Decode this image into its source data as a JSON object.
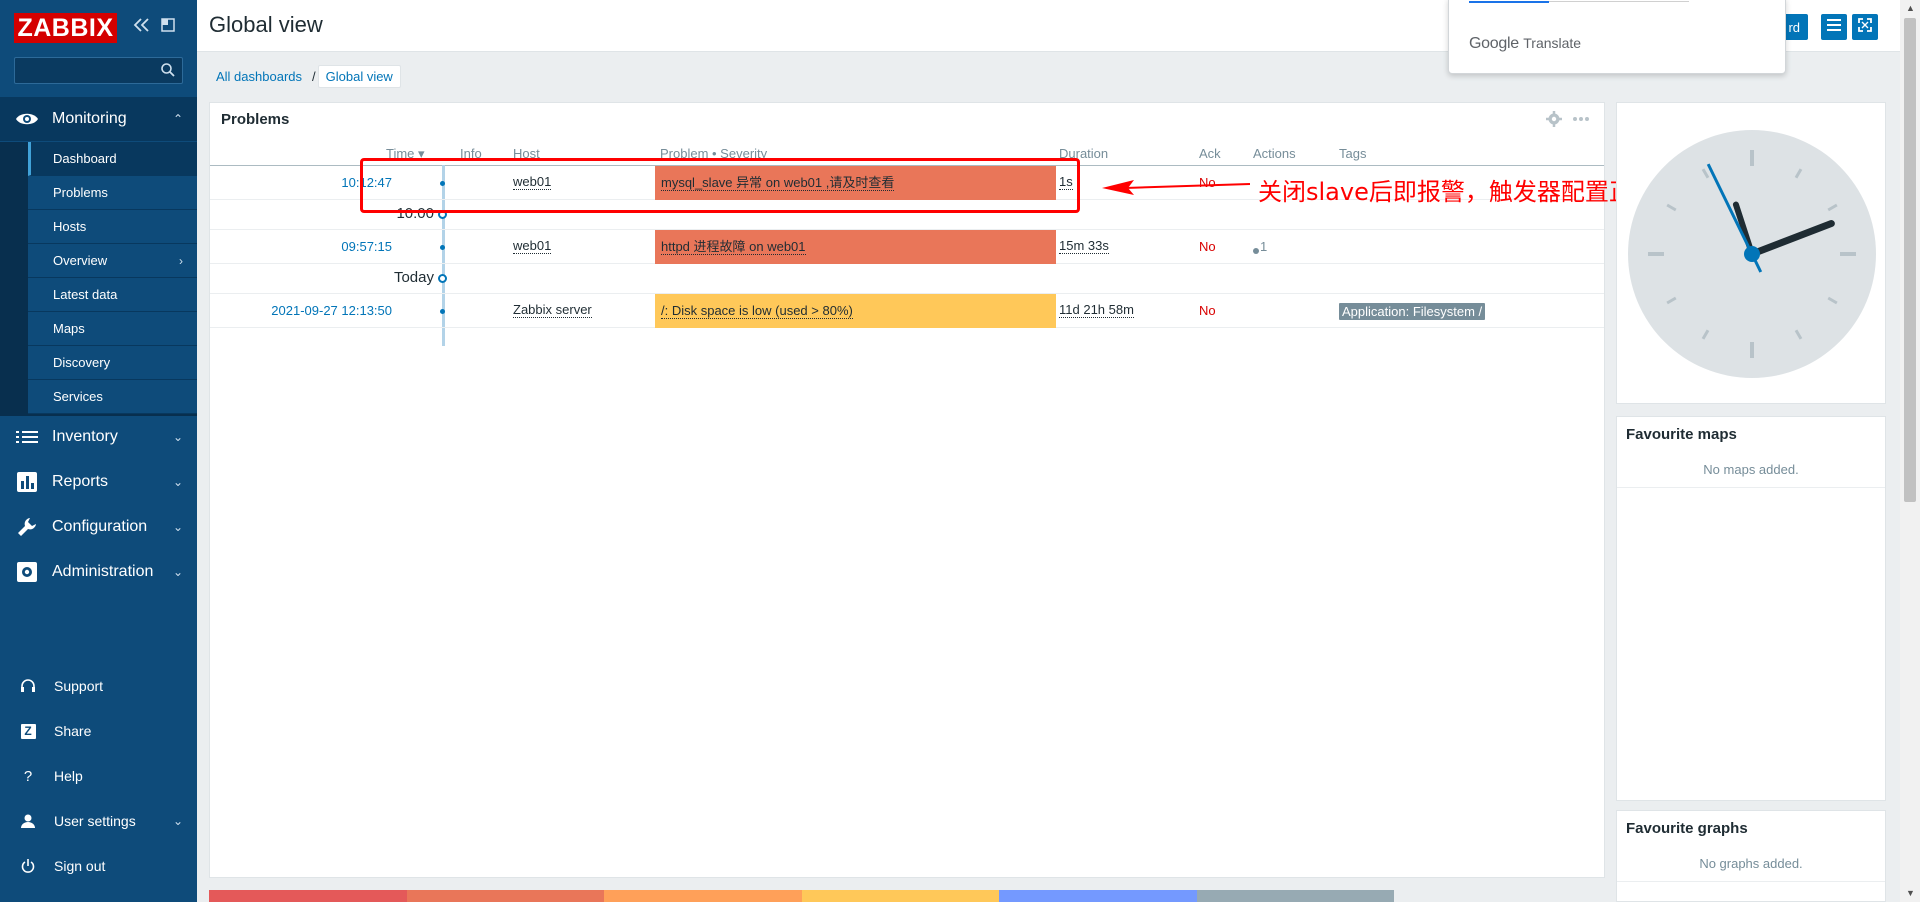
{
  "brand": {
    "logo_text": "ZABBIX"
  },
  "search": {
    "placeholder": ""
  },
  "sidebar": {
    "monitoring": "Monitoring",
    "monitoring_sub": [
      "Dashboard",
      "Problems",
      "Hosts",
      "Overview",
      "Latest data",
      "Maps",
      "Discovery",
      "Services"
    ],
    "inventory": "Inventory",
    "reports": "Reports",
    "configuration": "Configuration",
    "administration": "Administration",
    "footer": [
      "Support",
      "Share",
      "Help",
      "User settings",
      "Sign out"
    ],
    "share_glyph": "Z",
    "help_glyph": "?"
  },
  "header": {
    "title": "Global view",
    "edit_label": "rd"
  },
  "translate": {
    "google": "Google",
    "translate": "Translate"
  },
  "breadcrumb": {
    "root": "All dashboards",
    "sep": "/",
    "current": "Global view"
  },
  "problems": {
    "title": "Problems",
    "columns": {
      "time": "Time",
      "info": "Info",
      "host": "Host",
      "problem": "Problem • Severity",
      "duration": "Duration",
      "ack": "Ack",
      "actions": "Actions",
      "tags": "Tags"
    },
    "time_sort": "▾",
    "rows": [
      {
        "time": "10:12:47",
        "host": "web01",
        "problem": "mysql_slave 异常 on web01 ,请及时查看",
        "duration": "1s",
        "ack": "No",
        "actions": "",
        "tag": "",
        "color": "#e97659"
      },
      {
        "group": "10:00"
      },
      {
        "time": "09:57:15",
        "host": "web01",
        "problem": "httpd 进程故障 on web01",
        "duration": "15m 33s",
        "ack": "No",
        "actions": "1",
        "tag": "",
        "color": "#e97659"
      },
      {
        "group": "Today"
      },
      {
        "time": "2021-09-27 12:13:50",
        "host": "Zabbix server",
        "problem": "/: Disk space is low (used > 80%)",
        "duration": "11d 21h 58m",
        "ack": "No",
        "actions": "",
        "tag": "Application: Filesystem /",
        "color": "#ffc859"
      }
    ]
  },
  "annotation": {
    "text": "关闭slave后即报警，触发器配置正常",
    "color": "#ff0000"
  },
  "clock": {
    "hours": 14.3,
    "minutes": 57
  },
  "favourite_maps": {
    "title": "Favourite maps",
    "empty": "No maps added."
  },
  "favourite_graphs": {
    "title": "Favourite graphs",
    "empty": "No graphs added."
  },
  "severity_colors": [
    "#e45959",
    "#e97659",
    "#ffa059",
    "#ffc859",
    "#7499ff",
    "#97aab3"
  ]
}
